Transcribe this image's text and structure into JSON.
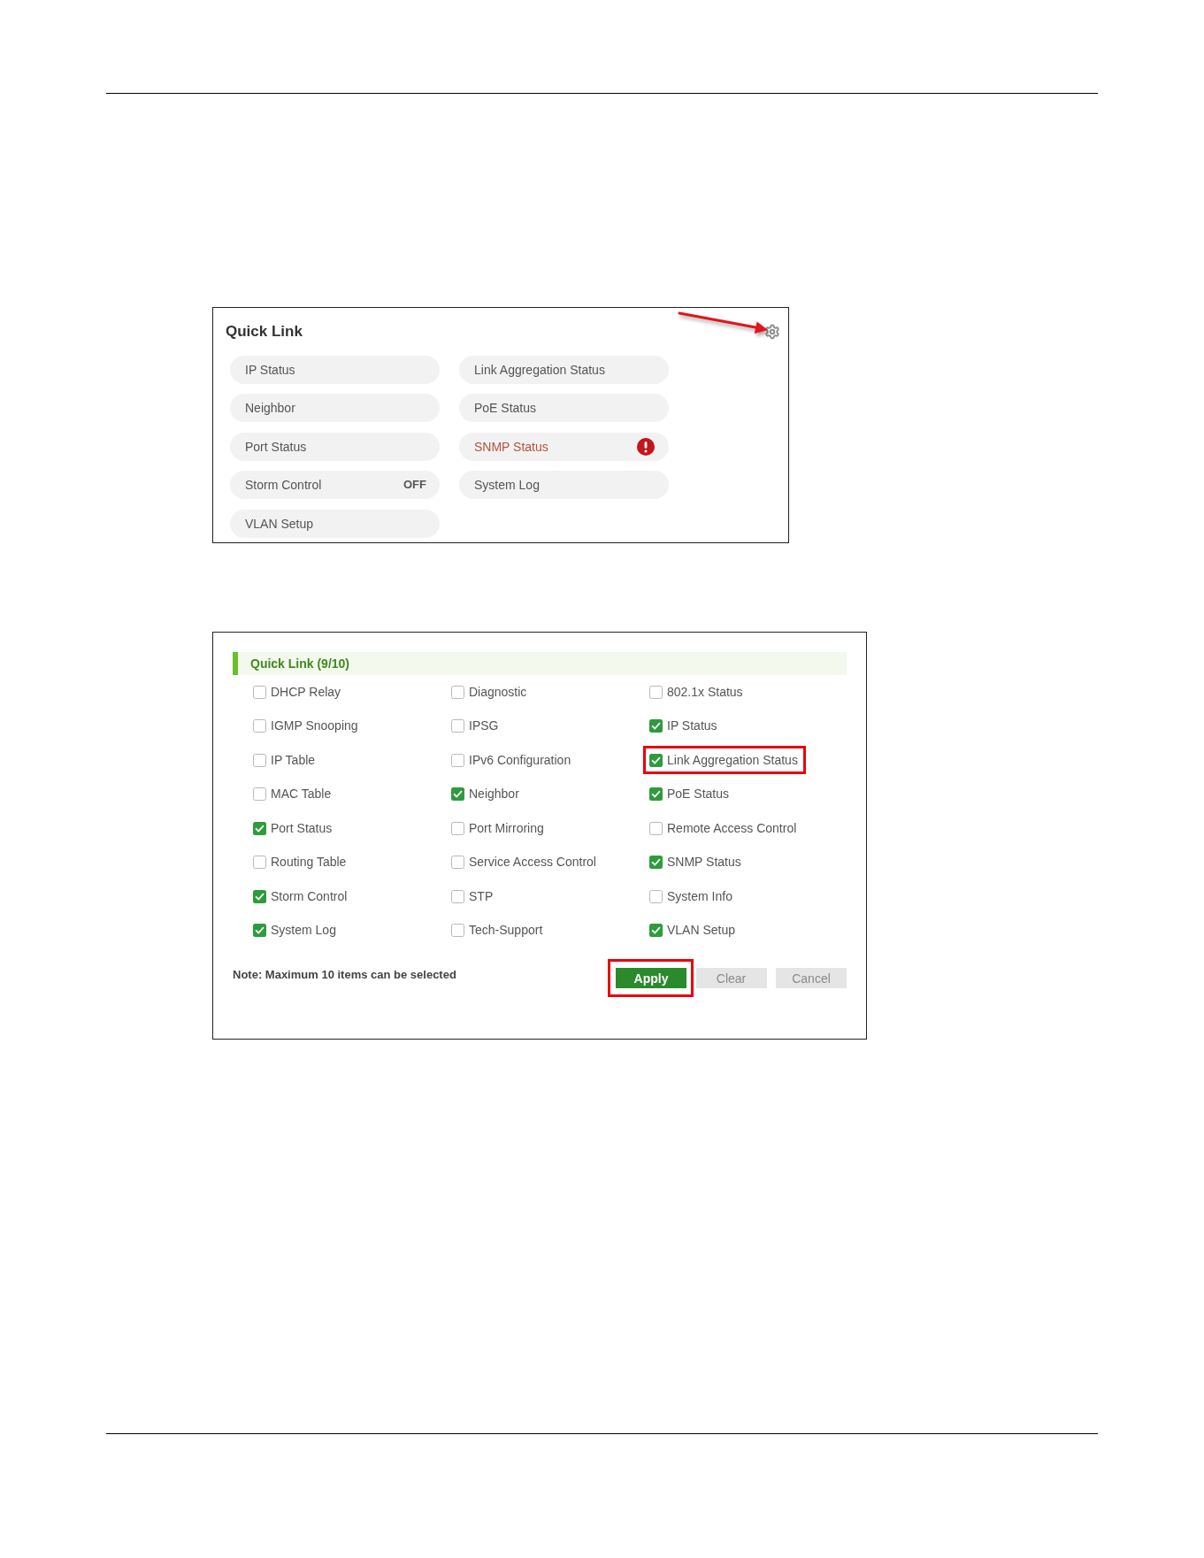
{
  "quick_link": {
    "title": "Quick Link",
    "links": [
      {
        "label": "IP Status",
        "alert": false
      },
      {
        "label": "Link Aggregation Status",
        "alert": false
      },
      {
        "label": "Neighbor",
        "alert": false
      },
      {
        "label": "PoE Status",
        "alert": false
      },
      {
        "label": "Port Status",
        "alert": false
      },
      {
        "label": "SNMP Status",
        "alert": true
      },
      {
        "label": "Storm Control",
        "alert": false,
        "status": "OFF"
      },
      {
        "label": "System Log",
        "alert": false
      },
      {
        "label": "VLAN Setup",
        "alert": false
      }
    ]
  },
  "quick_link_settings": {
    "title": "Quick Link (9/10)",
    "options": [
      {
        "label": "DHCP Relay",
        "checked": false,
        "highlighted": false
      },
      {
        "label": "Diagnostic",
        "checked": false,
        "highlighted": false
      },
      {
        "label": "802.1x Status",
        "checked": false,
        "highlighted": false
      },
      {
        "label": "IGMP Snooping",
        "checked": false,
        "highlighted": false
      },
      {
        "label": "IPSG",
        "checked": false,
        "highlighted": false
      },
      {
        "label": "IP Status",
        "checked": true,
        "highlighted": false
      },
      {
        "label": "IP Table",
        "checked": false,
        "highlighted": false
      },
      {
        "label": "IPv6 Configuration",
        "checked": false,
        "highlighted": false
      },
      {
        "label": "Link Aggregation Status",
        "checked": true,
        "highlighted": true
      },
      {
        "label": "MAC Table",
        "checked": false,
        "highlighted": false
      },
      {
        "label": "Neighbor",
        "checked": true,
        "highlighted": false
      },
      {
        "label": "PoE Status",
        "checked": true,
        "highlighted": false
      },
      {
        "label": "Port Status",
        "checked": true,
        "highlighted": false
      },
      {
        "label": "Port Mirroring",
        "checked": false,
        "highlighted": false
      },
      {
        "label": "Remote Access Control",
        "checked": false,
        "highlighted": false
      },
      {
        "label": "Routing Table",
        "checked": false,
        "highlighted": false
      },
      {
        "label": "Service Access Control",
        "checked": false,
        "highlighted": false
      },
      {
        "label": "SNMP Status",
        "checked": true,
        "highlighted": false
      },
      {
        "label": "Storm Control",
        "checked": true,
        "highlighted": false
      },
      {
        "label": "STP",
        "checked": false,
        "highlighted": false
      },
      {
        "label": "System Info",
        "checked": false,
        "highlighted": false
      },
      {
        "label": "System Log",
        "checked": true,
        "highlighted": false
      },
      {
        "label": "Tech-Support",
        "checked": false,
        "highlighted": false
      },
      {
        "label": "VLAN Setup",
        "checked": true,
        "highlighted": false
      }
    ],
    "note": "Note: Maximum 10 items can be selected",
    "buttons": [
      {
        "label": "Apply",
        "kind": "primary",
        "highlighted": true
      },
      {
        "label": "Clear",
        "kind": "secondary",
        "highlighted": false
      },
      {
        "label": "Cancel",
        "kind": "secondary",
        "highlighted": false
      }
    ]
  }
}
